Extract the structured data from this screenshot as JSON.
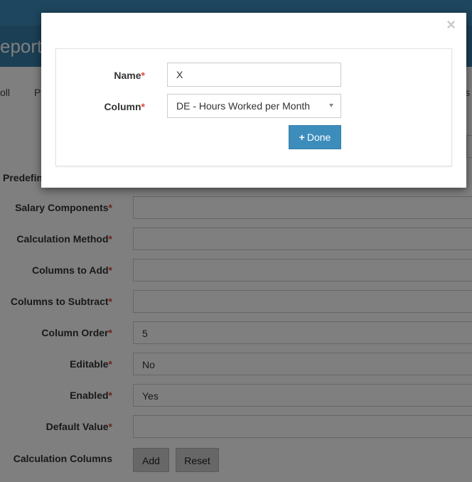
{
  "header": {
    "title_fragment": "eports"
  },
  "tabs": [
    "oll",
    "P",
    "s"
  ],
  "form": {
    "predefined_label": "Predefin",
    "rows": [
      {
        "label": "Salary Components",
        "required": "*",
        "value": ""
      },
      {
        "label": "Calculation Method",
        "required": "*",
        "value": ""
      },
      {
        "label": "Columns to Add",
        "required": "*",
        "value": ""
      },
      {
        "label": "Columns to Subtract",
        "required": "*",
        "value": ""
      },
      {
        "label": "Column Order",
        "required": "*",
        "value": "5"
      },
      {
        "label": "Editable",
        "required": "*",
        "value": "No"
      },
      {
        "label": "Enabled",
        "required": "*",
        "value": "Yes"
      },
      {
        "label": "Default Value",
        "required": "*",
        "value": ""
      }
    ],
    "calc_columns_label": "Calculation Columns",
    "add_label": "Add",
    "reset_label": "Reset"
  },
  "modal": {
    "close_glyph": "×",
    "name_label": "Name",
    "name_value": "X",
    "column_label": "Column",
    "column_value": "DE - Hours Worked per Month",
    "required": "*",
    "done_icon": "+",
    "done_label": "Done"
  },
  "colors": {
    "primary": "#3c8dbc",
    "required": "#dd4b39"
  }
}
